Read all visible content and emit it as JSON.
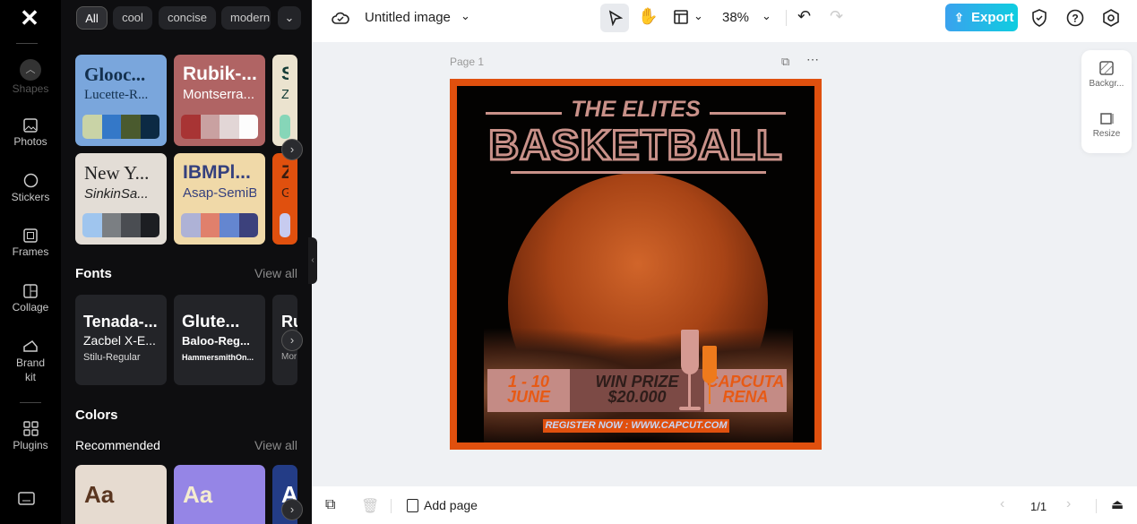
{
  "rail": {
    "items": [
      {
        "label": "Shapes"
      },
      {
        "label": "Photos"
      },
      {
        "label": "Stickers"
      },
      {
        "label": "Frames"
      },
      {
        "label": "Collage"
      },
      {
        "label": "Brand kit"
      },
      {
        "label": "Plugins"
      }
    ]
  },
  "panel": {
    "chips": [
      "All",
      "cool",
      "concise",
      "modern"
    ],
    "templates": [
      {
        "title": "Glooc...",
        "sub": "Lucette-R...",
        "bg": "#7aa6dc",
        "fg": "#13304e",
        "colors": [
          "#c9d3a6",
          "#3478c8",
          "#4a5a2e",
          "#0c2a44"
        ]
      },
      {
        "title": "Rubik-...",
        "sub": "Montserra...",
        "bg": "#b06464",
        "fg": "#ffffff",
        "colors": [
          "#a83434",
          "#c9a1a1",
          "#e2d6d6",
          "#fdfdfd"
        ]
      },
      {
        "title": "Sp",
        "sub": "ZY",
        "bg": "#ebe3cf",
        "fg": "#143c36",
        "colors": [
          "#86d6b8"
        ]
      },
      {
        "title": "New Y...",
        "sub": "SinkinSa...",
        "bg": "#e3ddd6",
        "fg": "#222",
        "colors": [
          "#9fc5ee",
          "#7b7f83",
          "#4a4d52",
          "#1c1e22"
        ]
      },
      {
        "title": "IBMPl...",
        "sub": "Asap-SemiB...",
        "bg": "#f0d9a8",
        "fg": "#35407e",
        "colors": [
          "#aeb2d6",
          "#e0806c",
          "#6486d0",
          "#3c417c"
        ]
      },
      {
        "title": "Z",
        "sub": "Gro",
        "bg": "#e0500e",
        "fg": "#3a1d10",
        "colors": [
          "#c7cbef"
        ]
      }
    ],
    "fonts_title": "Fonts",
    "view_all": "View all",
    "fonts": [
      {
        "a": "Tenada-...",
        "b": "Zacbel X-E...",
        "c": "Stilu-Regular"
      },
      {
        "a": "Glute...",
        "b": "Baloo-Reg...",
        "c": "HammersmithOn..."
      },
      {
        "a": "Ru",
        "b": "",
        "c": "Mor"
      }
    ],
    "colors_title": "Colors",
    "recommended": "Recommended",
    "color_cards": [
      {
        "aa": "Aa",
        "bg": "#e6dbd0",
        "fg": "#5a3620"
      },
      {
        "aa": "Aa",
        "bg": "#9585e6",
        "fg": "#f5ecd0"
      },
      {
        "aa": "A",
        "bg": "#233c86",
        "fg": "#fff"
      }
    ]
  },
  "top": {
    "title": "Untitled image",
    "zoom": "38%",
    "export": "Export"
  },
  "canvas": {
    "page_label": "Page 1"
  },
  "poster": {
    "line1": "THE ELITES",
    "line2": "BASKETBALL",
    "date": "1 - 10\nJUNE",
    "prize": "WIN PRIZE\n$20.000",
    "venue": "CAPCUTA\nRENA",
    "register": "REGISTER NOW : WWW.CAPCUT.COM"
  },
  "side": {
    "background": "Backgr...",
    "resize": "Resize"
  },
  "bottom": {
    "add_page": "Add page",
    "pager": "1/1"
  },
  "colors": {
    "accent": "#1fb6e8",
    "poster_border": "#e0500e"
  }
}
